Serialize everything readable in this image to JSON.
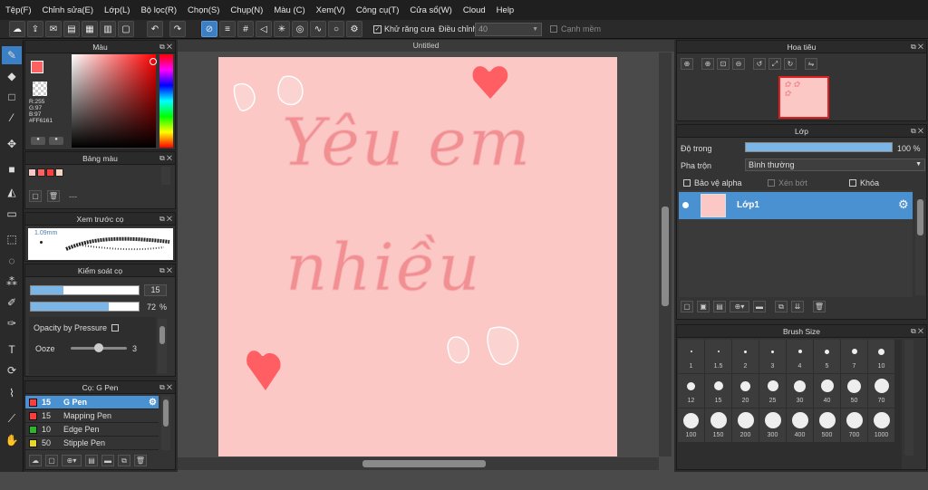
{
  "menubar": {
    "items": [
      "Tệp(F)",
      "Chỉnh sửa(E)",
      "Lớp(L)",
      "Bộ lọc(R)",
      "Chọn(S)",
      "Chụp(N)",
      "Màu (C)",
      "Xem(V)",
      "Công cụ(T)",
      "Cửa sổ(W)",
      "Cloud",
      "Help"
    ]
  },
  "toolbar": {
    "antialias_label": "Khử răng cưa",
    "correction_label": "Điều chỉnh",
    "correction_value": "40",
    "smooth_label": "Cạnh mềm"
  },
  "color_panel": {
    "title": "Màu",
    "r": "R:255",
    "g": "G:97",
    "b": "B:97",
    "hex": "#FF6161",
    "fg_color": "#ff6161"
  },
  "palette_panel": {
    "title": "Bảng màu",
    "swatches": [
      "#f7c9c6",
      "#ff6161",
      "#ff3d3d",
      "#f5d3c0"
    ],
    "dashes": "---"
  },
  "brush_preview": {
    "title": "Xem trước cọ",
    "size": "1.09mm"
  },
  "brush_control": {
    "title": "Kiểm soát cọ",
    "size_value": "15",
    "size_fill": 0.3,
    "opacity_value": "72",
    "opacity_unit": "%",
    "opacity_fill": 0.72,
    "pressure_label": "Opacity by Pressure",
    "ooze_label": "Ooze",
    "ooze_value": "3",
    "ooze_fill": 0.5
  },
  "brush_list": {
    "title": "Cọ: G Pen",
    "items": [
      {
        "size": "15",
        "name": "G Pen",
        "color": "#ff3d3d"
      },
      {
        "size": "15",
        "name": "Mapping Pen",
        "color": "#ff3d3d"
      },
      {
        "size": "10",
        "name": "Edge Pen",
        "color": "#2ab82a"
      },
      {
        "size": "50",
        "name": "Stipple Pen",
        "color": "#e8d826"
      }
    ]
  },
  "canvas": {
    "tab_title": "Untitled",
    "text_line1": "Yêu  em",
    "text_line2": "nhiều"
  },
  "navigator": {
    "title": "Hoa tiêu"
  },
  "layer_panel": {
    "title": "Lớp",
    "opacity_label": "Độ trong",
    "opacity_value": "100 %",
    "opacity_fill": 1.0,
    "blend_label": "Pha trộn",
    "blend_value": "Bình thường",
    "protect_alpha": "Bảo vệ alpha",
    "clipping": "Xén bớt",
    "lock": "Khóa",
    "layer_name": "Lớp1"
  },
  "brush_size": {
    "title": "Brush Size",
    "sizes": [
      "1",
      "1.5",
      "2",
      "3",
      "4",
      "5",
      "7",
      "10",
      "12",
      "15",
      "20",
      "25",
      "30",
      "40",
      "50",
      "70",
      "100",
      "150",
      "200",
      "300",
      "400",
      "500",
      "700",
      "1000"
    ]
  }
}
